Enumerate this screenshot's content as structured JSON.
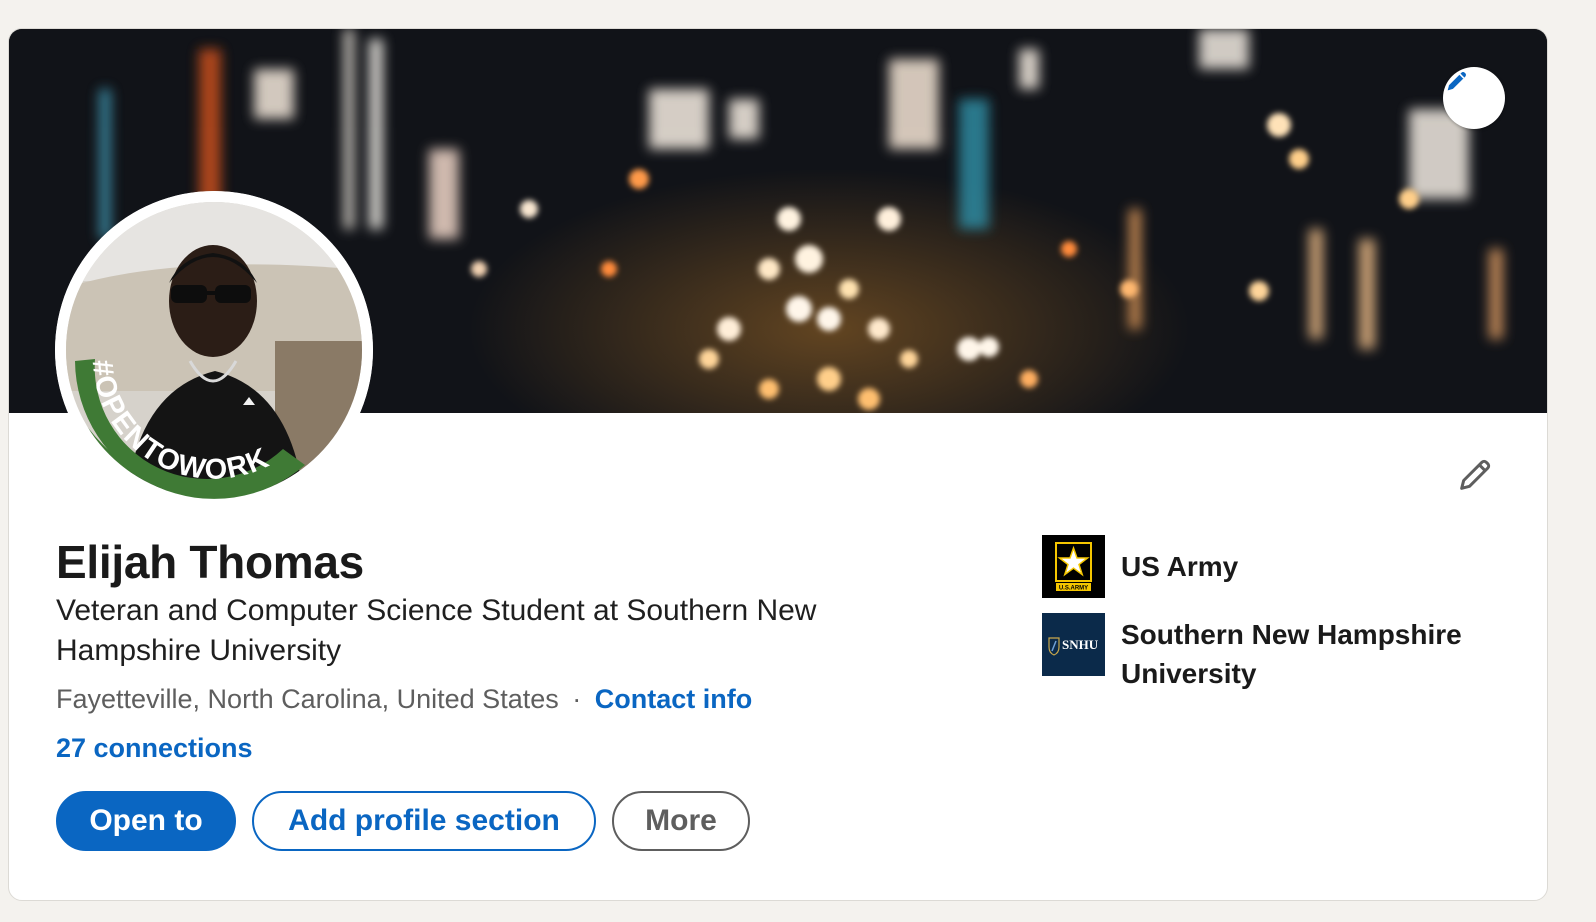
{
  "profile": {
    "name": "Elijah Thomas",
    "headline": "Veteran and Computer Science Student at Southern New Hampshire University",
    "location": "Fayetteville, North Carolina, United States",
    "separator": "·",
    "contact_info_label": "Contact info",
    "connections_label": "27 connections",
    "open_to_work_frame": "#OPENTOWORK"
  },
  "actions": {
    "open_to_label": "Open to",
    "add_section_label": "Add profile section",
    "more_label": "More"
  },
  "organizations": [
    {
      "name": "US Army",
      "logo_text": "U.S.ARMY",
      "icon": "army-star-logo"
    },
    {
      "name": "Southern New Hampshire University",
      "logo_text": "SNHU",
      "icon": "snhu-logo"
    }
  ],
  "icons": {
    "banner_edit": "pencil-icon",
    "intro_edit": "pencil-outline-icon"
  },
  "colors": {
    "accent": "#0a66c2",
    "open_to_work_green": "#3f7a35",
    "army_logo_bg": "#000000",
    "army_gold": "#f5c600",
    "snhu_logo_bg": "#0b2a4a",
    "text_primary": "#1a1a1a",
    "text_secondary": "#5e5e5e"
  }
}
